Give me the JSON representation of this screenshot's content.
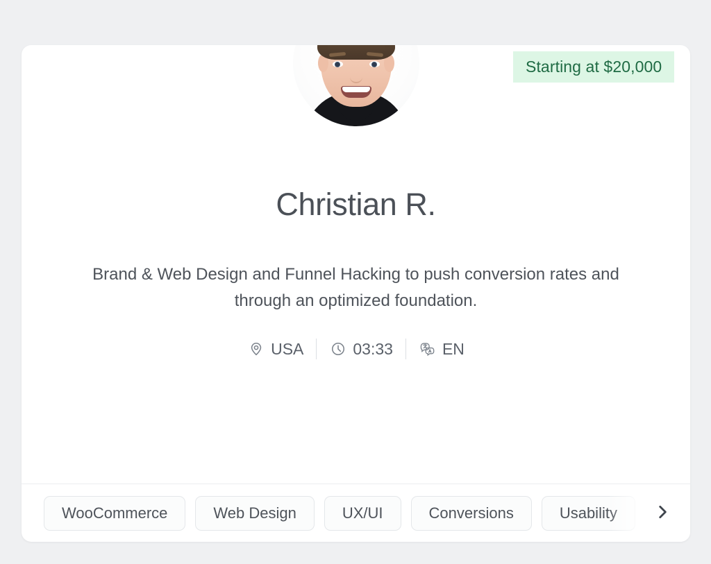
{
  "card": {
    "price_badge": {
      "label": "Starting at $20,000",
      "bg_color": "#ddf6e5",
      "text_color": "#1f6b44"
    },
    "avatar": {
      "icon": "user-avatar-photo",
      "alt": "Christian R."
    },
    "name": "Christian R.",
    "description": "Brand & Web Design and Funnel Hacking to push conversion rates and through an optimized foundation.",
    "meta": [
      {
        "icon": "location-pin-icon",
        "value": "USA"
      },
      {
        "icon": "clock-icon",
        "value": "03:33"
      },
      {
        "icon": "translate-icon",
        "value": "EN"
      }
    ],
    "tags": [
      "WooCommerce",
      "Web Design",
      "UX/UI",
      "Conversions",
      "Usability"
    ],
    "next_control": {
      "icon": "chevron-right-icon",
      "label": "Next tags"
    }
  },
  "theme": {
    "page_bg": "#eff0f2",
    "card_bg": "#ffffff",
    "text_primary": "#4b5057",
    "text_secondary": "#5a6069",
    "border": "#e4e7ea"
  }
}
